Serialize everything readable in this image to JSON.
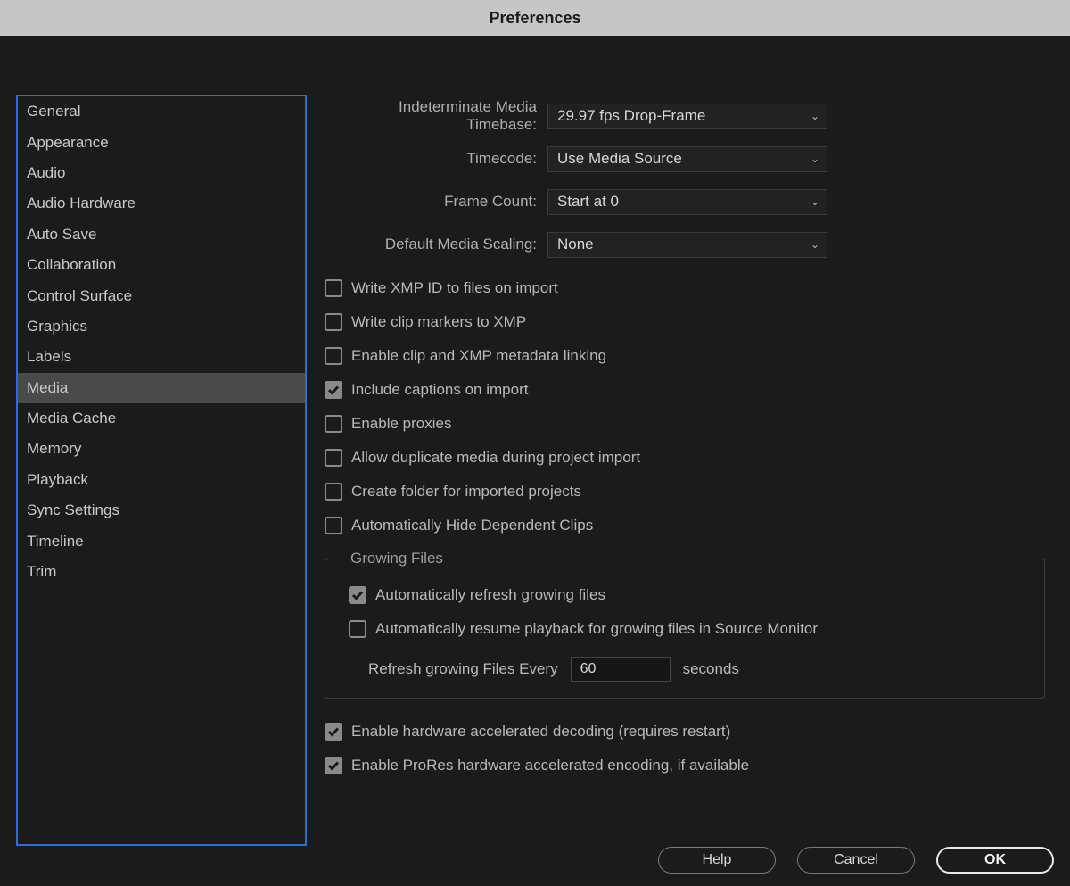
{
  "title": "Preferences",
  "sidebar": {
    "items": [
      "General",
      "Appearance",
      "Audio",
      "Audio Hardware",
      "Auto Save",
      "Collaboration",
      "Control Surface",
      "Graphics",
      "Labels",
      "Media",
      "Media Cache",
      "Memory",
      "Playback",
      "Sync Settings",
      "Timeline",
      "Trim"
    ],
    "selected_index": 9
  },
  "selects": {
    "timebase": {
      "label": "Indeterminate Media Timebase:",
      "value": "29.97 fps Drop-Frame"
    },
    "timecode": {
      "label": "Timecode:",
      "value": "Use Media Source"
    },
    "framecount": {
      "label": "Frame Count:",
      "value": "Start at 0"
    },
    "scaling": {
      "label": "Default Media Scaling:",
      "value": "None"
    }
  },
  "checks": {
    "xmp_id": {
      "label": "Write XMP ID to files on import",
      "checked": false
    },
    "clip_markers": {
      "label": "Write clip markers to XMP",
      "checked": false
    },
    "metadata_linking": {
      "label": "Enable clip and XMP metadata linking",
      "checked": false
    },
    "captions": {
      "label": "Include captions on import",
      "checked": true
    },
    "proxies": {
      "label": "Enable proxies",
      "checked": false
    },
    "dup_media": {
      "label": "Allow duplicate media during project import",
      "checked": false
    },
    "create_folder": {
      "label": "Create folder for imported projects",
      "checked": false
    },
    "hide_dependent": {
      "label": "Automatically Hide Dependent Clips",
      "checked": false
    }
  },
  "growing": {
    "legend": "Growing Files",
    "auto_refresh": {
      "label": "Automatically refresh growing files",
      "checked": true
    },
    "auto_resume": {
      "label": "Automatically resume playback for growing files in Source Monitor",
      "checked": false
    },
    "refresh_label": "Refresh growing Files Every",
    "refresh_value": "60",
    "refresh_suffix": "seconds"
  },
  "hw": {
    "decoding": {
      "label": "Enable hardware accelerated decoding (requires restart)",
      "checked": true
    },
    "prores": {
      "label": "Enable ProRes hardware accelerated encoding, if available",
      "checked": true
    }
  },
  "buttons": {
    "help": "Help",
    "cancel": "Cancel",
    "ok": "OK"
  }
}
